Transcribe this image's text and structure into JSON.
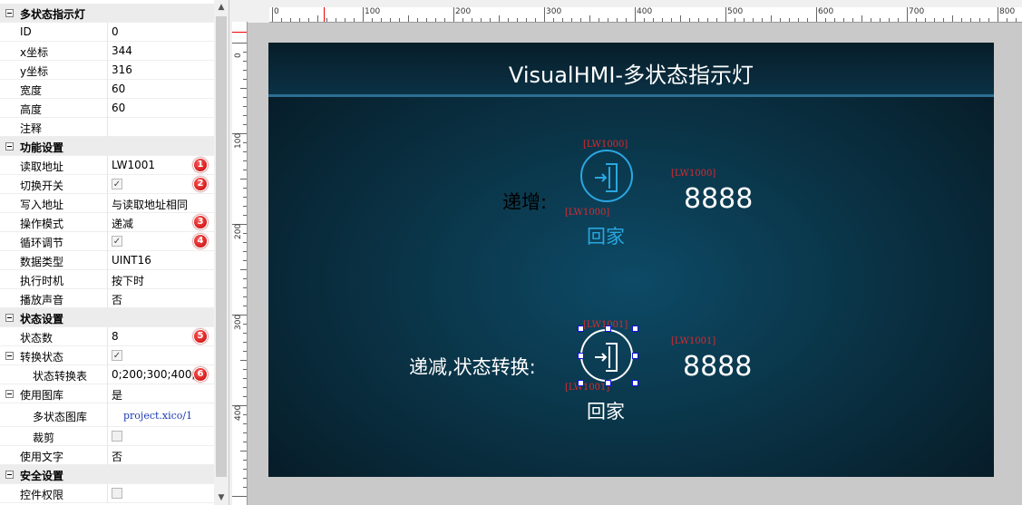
{
  "properties": {
    "sections": [
      {
        "title": "多状态指示灯",
        "rows": [
          {
            "label": "ID",
            "value": "0"
          },
          {
            "label": "x坐标",
            "value": "344"
          },
          {
            "label": "y坐标",
            "value": "316"
          },
          {
            "label": "宽度",
            "value": "60"
          },
          {
            "label": "高度",
            "value": "60"
          },
          {
            "label": "注释",
            "value": ""
          }
        ]
      },
      {
        "title": "功能设置",
        "rows": [
          {
            "label": "读取地址",
            "value": "LW1001",
            "badge": "1"
          },
          {
            "label": "切换开关",
            "checked": true,
            "badge": "2"
          },
          {
            "label": "写入地址",
            "value": "与读取地址相同"
          },
          {
            "label": "操作模式",
            "value": "递减",
            "badge": "3"
          },
          {
            "label": "循环调节",
            "checked": true,
            "badge": "4"
          },
          {
            "label": "数据类型",
            "value": "UINT16"
          },
          {
            "label": "执行时机",
            "value": "按下时"
          },
          {
            "label": "播放声音",
            "value": "否"
          }
        ]
      },
      {
        "title": "状态设置",
        "rows": [
          {
            "label": "状态数",
            "value": "8",
            "badge": "5"
          }
        ]
      }
    ],
    "state_convert": {
      "label": "转换状态",
      "checked": true
    },
    "state_table": {
      "label": "状态转换表",
      "value": "0;200;300;400;8",
      "badge": "6"
    },
    "use_gallery": {
      "label": "使用图库",
      "value": "是"
    },
    "multi_gallery": {
      "label": "多状态图库",
      "value": "project.xico/1"
    },
    "crop": {
      "label": "裁剪",
      "checked": false
    },
    "use_text": {
      "label": "使用文字",
      "value": "否"
    },
    "security": {
      "title": "安全设置"
    },
    "permission": {
      "label": "控件权限",
      "checked": false
    }
  },
  "ruler": {
    "h_labels": [
      "0",
      "100",
      "200",
      "300",
      "400",
      "500",
      "600",
      "700",
      "800"
    ],
    "v_labels": [
      "0",
      "100",
      "200",
      "300",
      "400"
    ]
  },
  "screen": {
    "title": "VisualHMI-多状态指示灯",
    "accent": "#2aa7e0",
    "widgets": [
      {
        "label": "递增:",
        "caption": "回家",
        "value": "8888",
        "tag_top": "[LW1000]",
        "tag_left": "[LW1000]",
        "tag_value": "[LW1000]",
        "color": "#2aa7e0"
      },
      {
        "label": "递减,状态转换:",
        "caption": "回家",
        "value": "8888",
        "tag_top": "[LW1001]",
        "tag_left": "[LW1001]",
        "tag_value": "[LW1001]",
        "color": "#ffffff"
      }
    ]
  }
}
